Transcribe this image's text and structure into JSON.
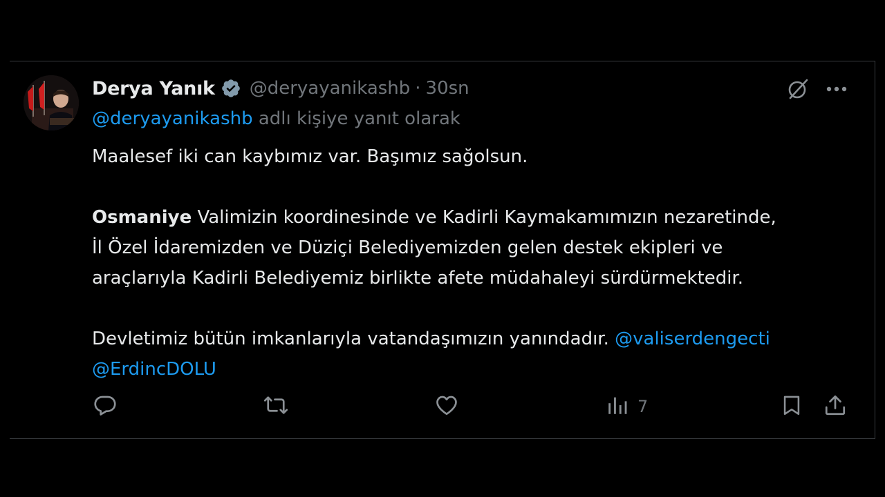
{
  "author": {
    "name": "Derya Yanık",
    "handle": "@deryayanikashb",
    "separator": "·",
    "time": "30sn"
  },
  "reply_context": {
    "mention": "@deryayanikashb",
    "text": " adlı kişiye yanıt olarak"
  },
  "body": {
    "line1": "Maalesef iki can kaybımız var. Başımız sağolsun.",
    "para2_bold": "Osmaniye",
    "para2_line1_rest": " Valimizin koordinesinde ve Kadirli Kaymakamımızın nezaretinde,",
    "para2_line2": "İl Özel İdaremizden ve Düziçi Belediyemizden gelen destek ekipleri ve",
    "para2_line3": "araçlarıyla Kadirli Belediyemiz birlikte afete müdahaleyi sürdürmektedir.",
    "para3_text": "Devletimiz bütün imkanlarıyla vatandaşımızın yanındadır. ",
    "mention1": "@valiserdengecti",
    "mention2": "@ErdincDOLU"
  },
  "actions": {
    "views": "7"
  },
  "icons": {
    "verified": "verified-badge-icon",
    "grok": "grok-icon",
    "more": "more-icon",
    "reply": "reply-icon",
    "retweet": "retweet-icon",
    "like": "like-icon",
    "views": "views-icon",
    "bookmark": "bookmark-icon",
    "share": "share-icon"
  },
  "colors": {
    "background": "#000000",
    "text": "#e7e9ea",
    "secondary": "#71767b",
    "accent": "#1d9bf0"
  }
}
